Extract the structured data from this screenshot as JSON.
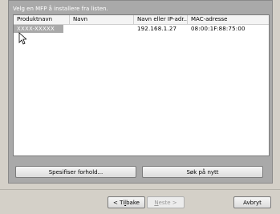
{
  "prompt": "Velg en MFP å installere fra listen.",
  "table": {
    "columns": [
      "Produktnavn",
      "Navn",
      "Navn eller IP-adr...",
      "MAC-adresse"
    ],
    "rows": [
      {
        "product": "XXXX-XXXXX",
        "name": "",
        "ip": "192.168.1.27",
        "mac": "08:00:1F:88:75:00"
      }
    ]
  },
  "buttons": {
    "specify": "Spesifiser forhold...",
    "search_again": "Søk på nytt"
  },
  "wizard": {
    "back_prefix": "< Ti",
    "back_hotkey": "l",
    "back_rest": "bake",
    "next_hotkey": "N",
    "next_rest": "este >",
    "cancel": "Avbryt"
  }
}
